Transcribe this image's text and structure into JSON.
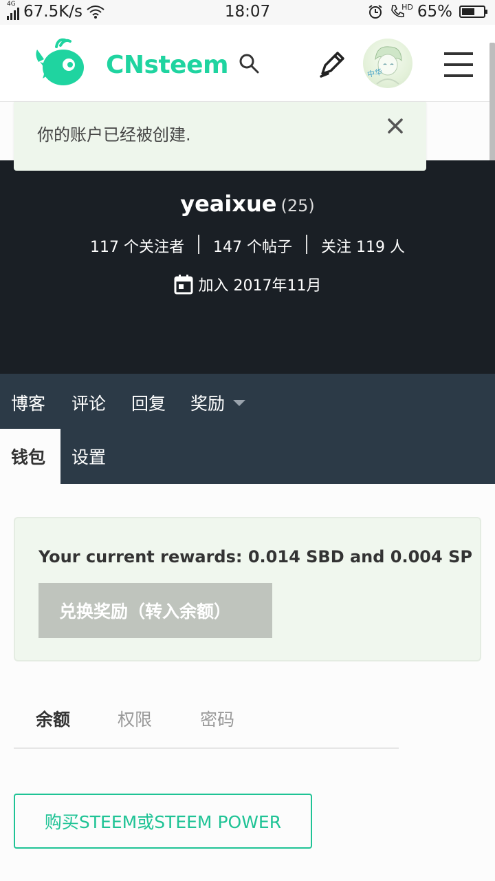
{
  "status_bar": {
    "network_type": "4G",
    "speed": "67.5K/s",
    "time": "18:07",
    "volte": "HD",
    "battery": "65%",
    "battery_level": 0.65
  },
  "header": {
    "brand": "CNsteem",
    "brand_color": "#1fd4a0",
    "icons": [
      "search-icon",
      "pen-icon",
      "menu-icon"
    ],
    "avatar_text": "中华"
  },
  "notice": {
    "text": "你的账户已经被创建."
  },
  "profile": {
    "username": "yeaixue",
    "reputation": "(25)",
    "followers": "117 个关注者",
    "posts": "147 个帖子",
    "following": "关注 119 人",
    "joined": "加入 2017年11月"
  },
  "nav": {
    "items": [
      {
        "label": "博客"
      },
      {
        "label": "评论"
      },
      {
        "label": "回复"
      },
      {
        "label": "奖励"
      },
      {
        "label": "钱包"
      },
      {
        "label": "设置"
      }
    ],
    "active": "钱包"
  },
  "rewards": {
    "text": "Your current rewards: 0.014 SBD and 0.004 SP",
    "claim_label": "兑换奖励（转入余额）"
  },
  "wallet_tabs": [
    {
      "label": "余额"
    },
    {
      "label": "权限"
    },
    {
      "label": "密码"
    }
  ],
  "buy_button_label": "购买STEEM或STEEM POWER",
  "colors": {
    "accent": "#1fc395",
    "banner_bg": "#1a1f25",
    "nav_bg": "#2c3a47",
    "notice_bg": "#eef6ec"
  }
}
